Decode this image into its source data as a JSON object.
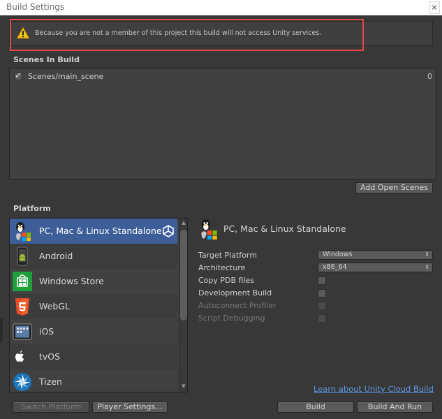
{
  "window": {
    "title": "Build Settings",
    "close_glyph": "×"
  },
  "warning": {
    "icon": "warning-icon",
    "text": "Because you are not a member of this project this build will not access Unity services."
  },
  "scenes": {
    "label": "Scenes In Build",
    "items": [
      {
        "name": "Scenes/main_scene",
        "index": "0",
        "checked": true
      }
    ],
    "add_open_scenes_label": "Add Open Scenes"
  },
  "platform": {
    "label": "Platform",
    "items": [
      {
        "label": "PC, Mac & Linux Standalone",
        "icon": "pc-mac-linux-icon",
        "selected": true
      },
      {
        "label": "Android",
        "icon": "android-icon"
      },
      {
        "label": "Windows Store",
        "icon": "windows-store-icon"
      },
      {
        "label": "WebGL",
        "icon": "html5-icon"
      },
      {
        "label": "iOS",
        "icon": "ios-icon"
      },
      {
        "label": "tvOS",
        "icon": "tvos-icon"
      },
      {
        "label": "Tizen",
        "icon": "tizen-icon"
      }
    ]
  },
  "settings": {
    "title": "PC, Mac & Linux Standalone",
    "target_platform": {
      "label": "Target Platform",
      "value": "Windows"
    },
    "architecture": {
      "label": "Architecture",
      "value": "x86_64"
    },
    "copy_pdb": {
      "label": "Copy PDB files",
      "checked": false
    },
    "development_build": {
      "label": "Development Build",
      "checked": false
    },
    "autoconnect_profiler": {
      "label": "Autoconnect Profiler",
      "checked": false,
      "disabled": true
    },
    "script_debugging": {
      "label": "Script Debugging",
      "checked": false,
      "disabled": true
    }
  },
  "footer": {
    "learn_link": "Learn about Unity Cloud Build",
    "switch_platform": "Switch Platform",
    "player_settings": "Player Settings...",
    "build": "Build",
    "build_and_run": "Build And Run"
  },
  "colors": {
    "background": "#383838",
    "selected_row": "#3d5e98",
    "warning_highlight": "#e3484a",
    "link": "#5e96e0"
  }
}
